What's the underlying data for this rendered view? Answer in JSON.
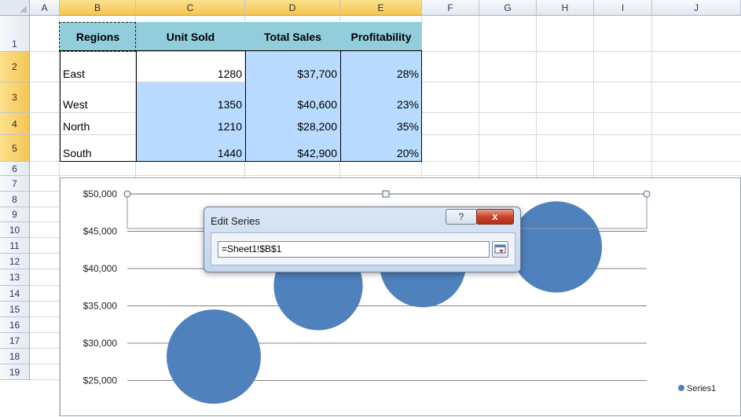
{
  "columns": [
    "A",
    "B",
    "C",
    "D",
    "E",
    "F",
    "G",
    "H",
    "I",
    "J"
  ],
  "rows": [
    "1",
    "2",
    "3",
    "4",
    "5",
    "6",
    "7",
    "8",
    "9",
    "10",
    "11",
    "12",
    "13",
    "14",
    "15",
    "16",
    "17",
    "18",
    "19"
  ],
  "table": {
    "headers": [
      "Regions",
      "Unit Sold",
      "Total Sales",
      "Profitability"
    ],
    "rows": [
      {
        "region": "East",
        "units": "1280",
        "sales": "$37,700",
        "profit": "28%"
      },
      {
        "region": "West",
        "units": "1350",
        "sales": "$40,600",
        "profit": "23%"
      },
      {
        "region": "North",
        "units": "1210",
        "sales": "$28,200",
        "profit": "35%"
      },
      {
        "region": "South",
        "units": "1440",
        "sales": "$42,900",
        "profit": "20%"
      }
    ]
  },
  "colors": {
    "header_fill": "#92cddc",
    "selected_fill": "#b8dbff",
    "bubble": "#4f81bd",
    "gridline": "#808080"
  },
  "chart_data": {
    "type": "scatter",
    "subtype": "bubble",
    "title": "",
    "xlabel": "",
    "ylabel": "",
    "ylim": [
      20000,
      50000
    ],
    "yticks": [
      "$50,000",
      "$45,000",
      "$40,000",
      "$35,000",
      "$30,000",
      "$25,000"
    ],
    "ytick_values": [
      50000,
      45000,
      40000,
      35000,
      30000,
      25000
    ],
    "legend": {
      "position": "right",
      "entries": [
        "Series1"
      ]
    },
    "series": [
      {
        "name": "Series1",
        "x": [
          1,
          2,
          3,
          4
        ],
        "y": [
          28200,
          37700,
          40600,
          42900
        ],
        "size": [
          1440,
          1280,
          1210,
          1350
        ]
      }
    ]
  },
  "dialog": {
    "title": "Edit Series",
    "help_icon": "?",
    "close_icon": "x",
    "series_name_value": "=Sheet1!$B$1"
  }
}
